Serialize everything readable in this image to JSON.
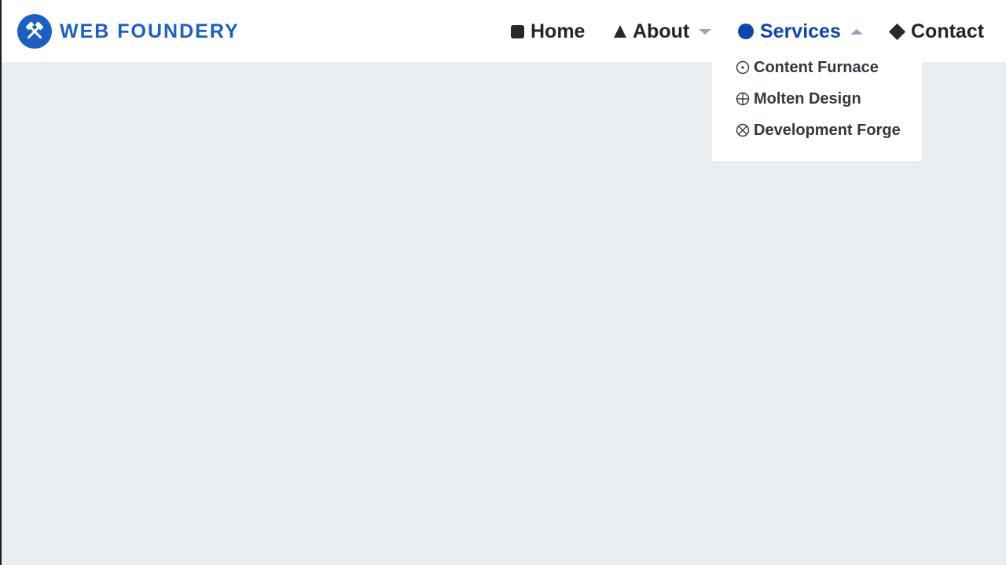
{
  "brand": {
    "name": "WEB FOUNDERY",
    "logo_icon": "crossed-hammers-icon",
    "color": "#1a5fc4"
  },
  "nav": {
    "items": [
      {
        "label": "Home",
        "icon": "square-icon"
      },
      {
        "label": "About",
        "icon": "triangle-icon",
        "has_dropdown": true,
        "expanded": false
      },
      {
        "label": "Services",
        "icon": "circle-icon",
        "has_dropdown": true,
        "expanded": true,
        "active": true
      },
      {
        "label": "Contact",
        "icon": "diamond-icon"
      }
    ],
    "active_color": "#0e46b0"
  },
  "services_dropdown": {
    "items": [
      {
        "label": "Content Furnace",
        "icon": "circle-dot-icon"
      },
      {
        "label": "Molten Design",
        "icon": "circle-plus-icon"
      },
      {
        "label": "Development Forge",
        "icon": "circle-x-icon"
      }
    ]
  },
  "page": {
    "background": "#eaeef1"
  }
}
